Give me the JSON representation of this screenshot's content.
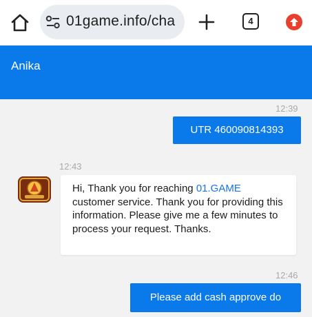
{
  "browser": {
    "url": "01game.info/cha",
    "tab_count": "4"
  },
  "chat": {
    "agent_name": "Anika",
    "messages": [
      {
        "time": "12:39",
        "text": "UTR 460090814393"
      },
      {
        "time": "12:43",
        "text_before": "Hi, Thank you for reaching ",
        "brand": "01.GAME",
        "text_after": " customer service. Thank you for providing this information. Please give me a few minutes to process your request. Thanks."
      },
      {
        "time": "12:46",
        "text": "Please add cash approve do"
      }
    ]
  },
  "colors": {
    "accent": "#0a79ea",
    "link": "#1a73e8",
    "update": "#e8402e"
  }
}
